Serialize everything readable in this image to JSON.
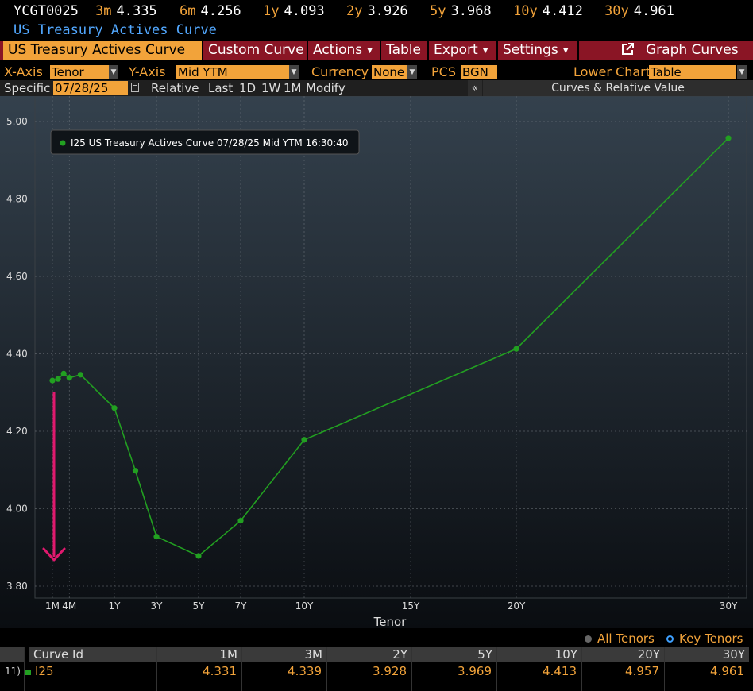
{
  "ticker": {
    "symbol": "YCGT0025",
    "items": [
      {
        "label": "3m",
        "value": "4.335"
      },
      {
        "label": "6m",
        "value": "4.256"
      },
      {
        "label": "1y",
        "value": "4.093"
      },
      {
        "label": "2y",
        "value": "3.926"
      },
      {
        "label": "5y",
        "value": "3.968"
      },
      {
        "label": "10y",
        "value": "4.412"
      },
      {
        "label": "30y",
        "value": "4.961"
      }
    ]
  },
  "subtitle": "US Treasury Actives Curve",
  "menubar": {
    "title_tab": "US Treasury Actives Curve",
    "custom_curve": "Custom Curve",
    "actions": "Actions",
    "table": "Table",
    "export": "Export",
    "settings": "Settings",
    "graph_curves": "Graph Curves"
  },
  "controls": {
    "xaxis_label": "X-Axis",
    "xaxis_value": "Tenor",
    "yaxis_label": "Y-Axis",
    "yaxis_value": "Mid YTM",
    "currency_label": "Currency",
    "currency_value": "None",
    "pcs_label": "PCS",
    "pcs_value": "BGN",
    "lower_chart_label": "Lower Chart",
    "lower_chart_value": "Table"
  },
  "specific_row": {
    "specific_label": "Specific",
    "date": "07/28/25",
    "relative": "Relative",
    "last": "Last",
    "d1": "1D",
    "w1": "1W",
    "m1": "1M",
    "modify": "Modify",
    "collapse": "«",
    "panel_title": "Curves & Relative Value"
  },
  "colors": {
    "accent": "#f2a33a",
    "menu_bg": "#8a1525",
    "series": "#22a021",
    "link_blue": "#52a8ff",
    "arrow": "#e0196e"
  },
  "chart_data": {
    "type": "line",
    "legend": "I25 US Treasury Actives Curve 07/28/25 Mid YTM 16:30:40",
    "legend_position": "top-left",
    "xlabel": "Tenor",
    "ylabel": "",
    "ylim": [
      3.8,
      5.0
    ],
    "xlim_years": [
      0,
      31
    ],
    "grid": true,
    "y_ticks": [
      "5.00",
      "4.80",
      "4.60",
      "4.40",
      "4.20",
      "4.00",
      "3.80"
    ],
    "x_ticks": [
      {
        "label": "1M",
        "years": 0.0833
      },
      {
        "label": "4M",
        "years": 0.3333
      },
      {
        "label": "1Y",
        "years": 1
      },
      {
        "label": "3Y",
        "years": 3
      },
      {
        "label": "5Y",
        "years": 5
      },
      {
        "label": "7Y",
        "years": 7
      },
      {
        "label": "10Y",
        "years": 10
      },
      {
        "label": "15Y",
        "years": 15
      },
      {
        "label": "20Y",
        "years": 20
      },
      {
        "label": "30Y",
        "years": 30
      }
    ],
    "series": [
      {
        "name": "I25",
        "points": [
          {
            "tenor": "1M",
            "years": 0.0833,
            "y": 4.331
          },
          {
            "tenor": "2M",
            "years": 0.1667,
            "y": 4.335
          },
          {
            "tenor": "3M",
            "years": 0.25,
            "y": 4.349
          },
          {
            "tenor": "4M",
            "years": 0.3333,
            "y": 4.338
          },
          {
            "tenor": "6M",
            "years": 0.5,
            "y": 4.346
          },
          {
            "tenor": "1Y",
            "years": 1,
            "y": 4.26
          },
          {
            "tenor": "2Y",
            "years": 2,
            "y": 4.098
          },
          {
            "tenor": "3Y",
            "years": 3,
            "y": 3.928
          },
          {
            "tenor": "5Y",
            "years": 5,
            "y": 3.878
          },
          {
            "tenor": "7Y",
            "years": 7,
            "y": 3.969
          },
          {
            "tenor": "10Y",
            "years": 10,
            "y": 4.178
          },
          {
            "tenor": "20Y",
            "years": 20,
            "y": 4.413
          },
          {
            "tenor": "30Y",
            "years": 30,
            "y": 4.957
          }
        ]
      }
    ]
  },
  "tenor_selector": {
    "all_tenors": "All Tenors",
    "key_tenors": "Key Tenors",
    "selected": "Key Tenors"
  },
  "table": {
    "columns": [
      "Curve Id",
      "1M",
      "3M",
      "2Y",
      "5Y",
      "10Y",
      "20Y",
      "30Y"
    ],
    "rows": [
      {
        "index": "11)",
        "curve_id": "I25",
        "values": [
          "4.331",
          "4.339",
          "3.928",
          "3.969",
          "4.413",
          "4.957",
          "4.961"
        ]
      }
    ]
  }
}
